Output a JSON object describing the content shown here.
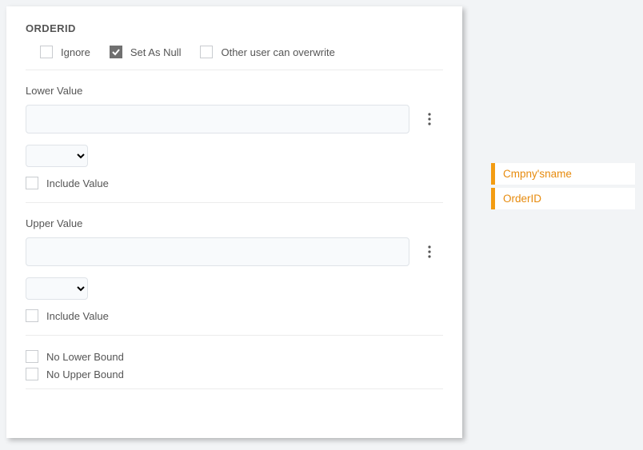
{
  "section": {
    "title": "ORDERID"
  },
  "options": {
    "ignore": {
      "label": "Ignore",
      "checked": false
    },
    "setNull": {
      "label": "Set As Null",
      "checked": true
    },
    "overwrite": {
      "label": "Other user can overwrite",
      "checked": false
    }
  },
  "lower": {
    "label": "Lower Value",
    "value": "",
    "selectValue": "",
    "include": {
      "label": "Include Value",
      "checked": false
    }
  },
  "upper": {
    "label": "Upper Value",
    "value": "",
    "selectValue": "",
    "include": {
      "label": "Include Value",
      "checked": false
    }
  },
  "bounds": {
    "noLower": {
      "label": "No Lower Bound",
      "checked": false
    },
    "noUpper": {
      "label": "No Upper Bound",
      "checked": false
    }
  },
  "side": {
    "items": [
      {
        "label": "Cmpny'sname"
      },
      {
        "label": "OrderID"
      }
    ]
  }
}
